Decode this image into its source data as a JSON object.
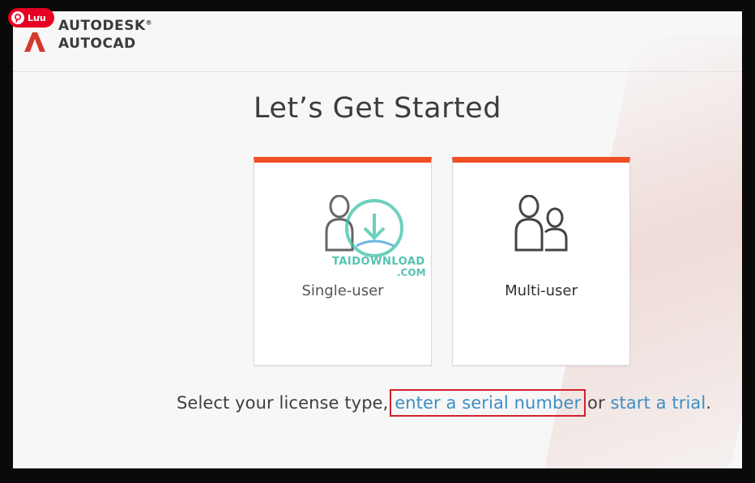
{
  "header": {
    "brand_top": "AUTODESK",
    "brand_trademark": "®",
    "brand_bottom": "AUTOCAD",
    "save_pill_label": "Lưu"
  },
  "main": {
    "title": "Let’s Get Started",
    "cards": [
      {
        "label": "Single-user"
      },
      {
        "label": "Multi-user"
      }
    ],
    "license_prompt_prefix": "Select your license type, ",
    "serial_link": "enter a serial number",
    "or_text": " or ",
    "trial_link": "start a trial",
    "period": "."
  },
  "watermark": {
    "line1": "TAIDOWNLOAD",
    "line2": ".COM"
  },
  "colors": {
    "accent_orange": "#f04e23",
    "link_blue": "#3b8fc4",
    "highlight_red": "#d4202b",
    "pinterest_red": "#e60023"
  }
}
